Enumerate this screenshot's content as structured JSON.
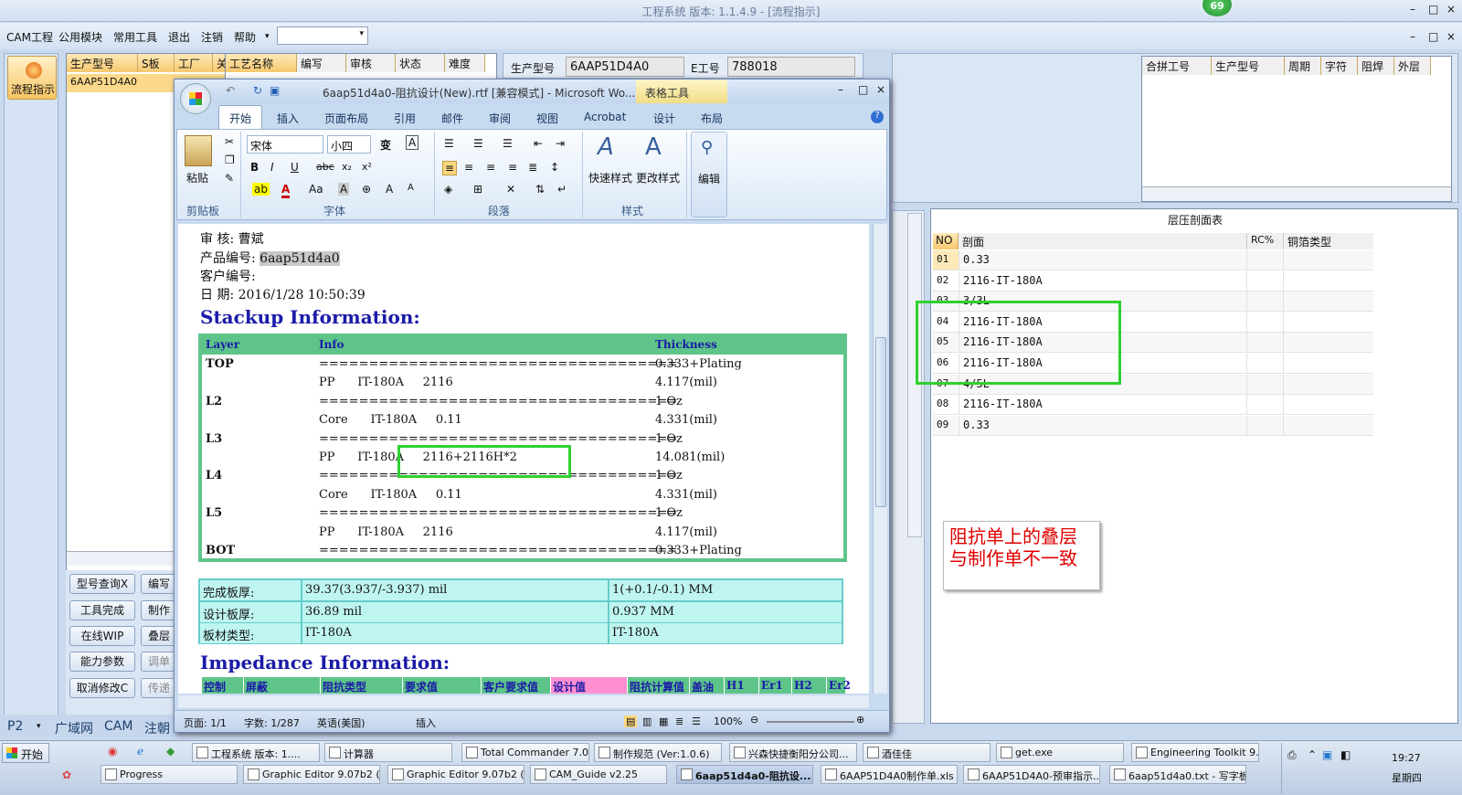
{
  "app": {
    "title": "工程系统  版本: 1.1.4.9 - [流程指示]",
    "badge": "69",
    "win_controls": [
      "–",
      "□",
      "×"
    ]
  },
  "menu": {
    "items": [
      "CAM工程",
      "公用模块",
      "常用工具",
      "退出",
      "注销",
      "帮助"
    ],
    "dropdown_arrow": "▾",
    "combo_value": ""
  },
  "left_nav": {
    "flow_label": "流程指示"
  },
  "grid1": {
    "headers": [
      "生产型号",
      "S板",
      "工厂",
      "关"
    ],
    "row": "6AAP51D4A0"
  },
  "grid2": {
    "headers": [
      "工艺名称",
      "编写",
      "审核",
      "状态",
      "难度"
    ]
  },
  "fields": {
    "model_label": "生产型号",
    "model_value": "6AAP51D4A0",
    "eno_label": "E工号",
    "eno_value": "788018"
  },
  "grid3": {
    "headers": [
      "合拼工号",
      "生产型号",
      "周期",
      "字符",
      "阻焊",
      "外层"
    ]
  },
  "buttons": [
    "型号查询X",
    "编写",
    "工具完成",
    "制作",
    "在线WIP",
    "叠层",
    "能力参数",
    "调单",
    "取消修改C",
    "传递"
  ],
  "bottom_tabs": [
    "P2",
    "广域网",
    "CAM",
    "注朝"
  ],
  "stack_table": {
    "title": "层压剖面表",
    "headers": [
      "NO",
      "剖面",
      "RC%",
      "铜箔类型"
    ],
    "rows": [
      [
        "01",
        "0.33"
      ],
      [
        "02",
        "2116-IT-180A"
      ],
      [
        "03",
        "3/3L"
      ],
      [
        "04",
        "2116-IT-180A"
      ],
      [
        "05",
        "2116-IT-180A"
      ],
      [
        "06",
        "2116-IT-180A"
      ],
      [
        "07",
        "4/5L"
      ],
      [
        "08",
        "2116-IT-180A"
      ],
      [
        "09",
        "0.33"
      ]
    ]
  },
  "annotation": {
    "text": "阻抗单上的叠层与制作单不一致",
    "color": "#e00000"
  },
  "word": {
    "title": "6aap51d4a0-阻抗设计(New).rtf [兼容模式] - Microsoft Wo...",
    "context_tab": "表格工具",
    "tabs": [
      "开始",
      "插入",
      "页面布局",
      "引用",
      "邮件",
      "审阅",
      "视图",
      "Acrobat",
      "设计",
      "布局"
    ],
    "font_name": "宋体",
    "font_size": "小四",
    "groups": [
      "剪贴板",
      "字体",
      "段落",
      "样式"
    ],
    "paste": "粘贴",
    "quick_style": "快速样式",
    "change_style": "更改样式",
    "edit": "编辑",
    "status": {
      "page": "页面: 1/1",
      "words": "字数: 1/287",
      "lang": "英语(美国)",
      "mode": "插入",
      "zoom": "100%"
    }
  },
  "doc": {
    "reviewer": "审    核: 曹斌",
    "product_label": "产品编号: ",
    "product_value": "6aap51d4a0",
    "customer": "客户编号: ",
    "date": "日    期: 2016/1/28 10:50:39",
    "stack_title": "Stackup Information:",
    "stack_headers": [
      "Layer",
      "Info",
      "Thickness"
    ],
    "stack_rows": [
      [
        "TOP",
        "====================================",
        "0.333+Plating"
      ],
      [
        "",
        "PP      IT-180A     2116",
        "4.117(mil)"
      ],
      [
        "L2",
        "====================================",
        "1 Oz"
      ],
      [
        "",
        "Core      IT-180A     0.11",
        "4.331(mil)"
      ],
      [
        "L3",
        "====================================",
        "1 Oz"
      ],
      [
        "",
        "PP      IT-180A     2116+2116H*2",
        "14.081(mil)"
      ],
      [
        "L4",
        "====================================",
        "1 Oz"
      ],
      [
        "",
        "Core      IT-180A     0.11",
        "4.331(mil)"
      ],
      [
        "L5",
        "====================================",
        "1 Oz"
      ],
      [
        "",
        "PP      IT-180A     2116",
        "4.117(mil)"
      ],
      [
        "BOT",
        "====================================",
        "0.333+Plating"
      ]
    ],
    "thick_rows": [
      [
        "完成板厚:",
        "39.37(3.937/-3.937) mil",
        "1(+0.1/-0.1) MM"
      ],
      [
        "设计板厚:",
        "36.89 mil",
        "0.937 MM"
      ],
      [
        "板材类型:",
        "IT-180A",
        "IT-180A"
      ]
    ],
    "imp_title": "Impedance Information:",
    "imp_headers": [
      "控制",
      "屏蔽",
      "阻抗类型",
      "要求值",
      "客户要求值",
      "设计值",
      "阻抗计算值",
      "盖油",
      "H1",
      "Er1",
      "H2",
      "Er2"
    ]
  },
  "taskbar": {
    "start": "开始",
    "row1": [
      "工程系统  版本: 1....",
      "计算器",
      "Total Commander 7.0 ...",
      "制作规范 (Ver:1.0.6)",
      "兴森快捷衡阳分公司...",
      "酒佳佳",
      "get.exe",
      "Engineering Toolkit 9...."
    ],
    "row2": [
      "Progress",
      "Graphic Editor 9.07b2 (0...",
      "Graphic Editor 9.07b2 (0...",
      "CAM_Guide v2.25",
      "6aap51d4a0-阻抗设...",
      "6AAP51D4A0制作单.xls ...",
      "6AAP51D4A0-预审指示...",
      "6aap51d4a0.txt - 写字板"
    ],
    "time": "19:27",
    "day": "星期四"
  }
}
